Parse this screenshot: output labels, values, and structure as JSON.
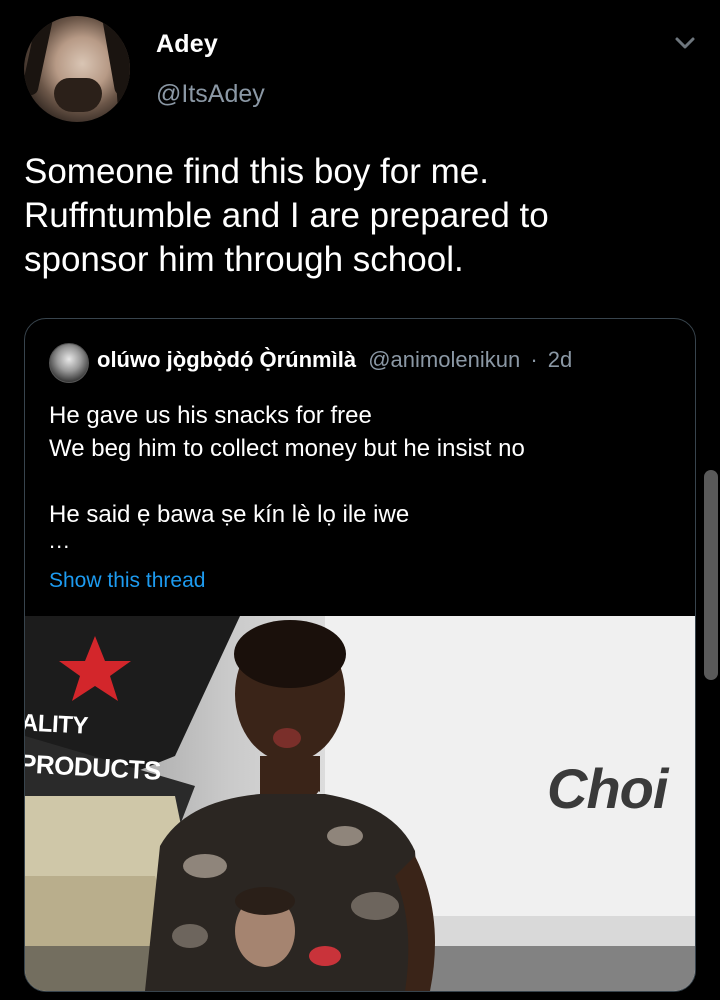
{
  "author": {
    "display_name": "Adey",
    "handle": "@ItsAdey"
  },
  "tweet": {
    "text": "Someone find this boy for me.\nRuffntumble and I are prepared to\nsponsor him through school."
  },
  "quoted": {
    "display_name": "olúwo jọ̀gbọ̀dọ́ Ọ̀rúnmìlà",
    "handle": "@animolenikun",
    "separator": "·",
    "time": "2d",
    "lines": [
      "He gave us his snacks  for free",
      "We beg him to collect money but he insist no",
      "He said ẹ bawa ṣe kín lè lọ ile iwe"
    ],
    "ellipsis": "...",
    "show_thread": "Show this thread"
  },
  "photo": {
    "sign_text_1": "ALITY",
    "sign_text_2": "PRODUCTS",
    "sign_text_3": "Choi"
  },
  "colors": {
    "background": "#000000",
    "text": "#ffffff",
    "secondary": "#8b98a5",
    "link": "#1d9bf0",
    "border": "#38444d"
  },
  "icons": {
    "more": "chevron-down-icon"
  }
}
